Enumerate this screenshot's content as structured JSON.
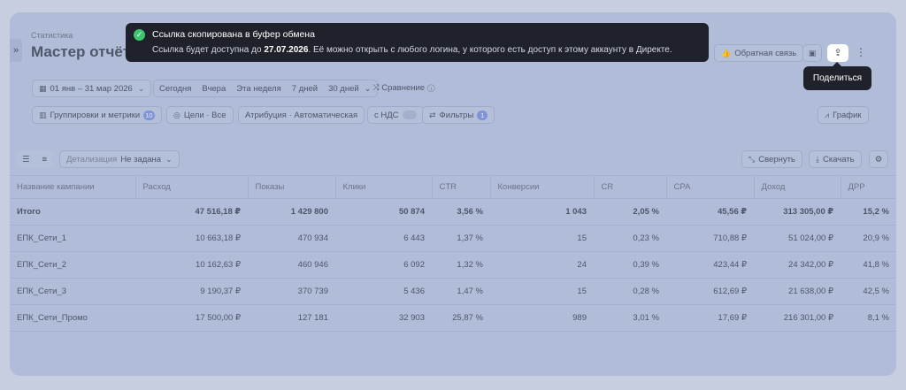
{
  "sidebar_toggle": "»",
  "breadcrumb": "Статистика",
  "page_title": "Мастер отчётов",
  "header": {
    "feedback_label": "Обратная связь",
    "save_icon": "save-icon",
    "share_icon": "share-icon",
    "more_icon": "more-icon"
  },
  "date_filter": {
    "range": "01 янв – 31 мар 2026",
    "presets": [
      "Сегодня",
      "Вчера",
      "Эта неделя",
      "7 дней",
      "30 дней"
    ],
    "compare_label": "Сравнение"
  },
  "filters": {
    "groupings_label": "Группировки и метрики",
    "groupings_count": "10",
    "goals_label": "Цели · Все",
    "attribution_label": "Атрибуция · Автоматическая",
    "vat_label": "с НДС",
    "filters_label": "Фильтры",
    "filters_count": "1",
    "chart_label": "График"
  },
  "table_toolbar": {
    "detail_label": "Детализация",
    "detail_value": "Не задана",
    "collapse_label": "Свернуть",
    "download_label": "Скачать"
  },
  "table": {
    "columns": [
      "Название кампании",
      "Расход",
      "Показы",
      "Клики",
      "CTR",
      "Конверсии",
      "CR",
      "CPA",
      "Доход",
      "ДРР"
    ],
    "rows": [
      [
        "Итого",
        "47 516,18 ₽",
        "1 429 800",
        "50 874",
        "3,56 %",
        "1 043",
        "2,05 %",
        "45,56 ₽",
        "313 305,00 ₽",
        "15,2 %"
      ],
      [
        "ЕПК_Сети_1",
        "10 663,18 ₽",
        "470 934",
        "6 443",
        "1,37 %",
        "15",
        "0,23 %",
        "710,88 ₽",
        "51 024,00 ₽",
        "20,9 %"
      ],
      [
        "ЕПК_Сети_2",
        "10 162,63 ₽",
        "460 946",
        "6 092",
        "1,32 %",
        "24",
        "0,39 %",
        "423,44 ₽",
        "24 342,00 ₽",
        "41,8 %"
      ],
      [
        "ЕПК_Сети_3",
        "9 190,37 ₽",
        "370 739",
        "5 436",
        "1,47 %",
        "15",
        "0,28 %",
        "612,69 ₽",
        "21 638,00 ₽",
        "42,5 %"
      ],
      [
        "ЕПК_Сети_Промо",
        "17 500,00 ₽",
        "127 181",
        "32 903",
        "25,87 %",
        "989",
        "3,01 %",
        "17,69 ₽",
        "216 301,00 ₽",
        "8,1 %"
      ]
    ]
  },
  "toast": {
    "title": "Ссылка скопирована в буфер обмена",
    "text_before": "Ссылка будет доступна до ",
    "date": "27.07.2026",
    "text_after": ". Её можно открыть с любого логина, у которого есть доступ к этому аккаунту в Директе."
  },
  "tooltip": "Поделиться"
}
